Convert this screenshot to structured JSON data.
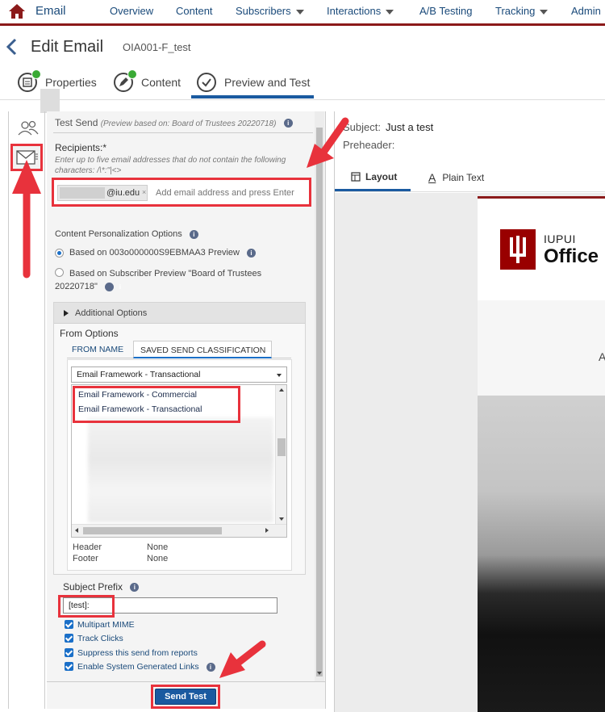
{
  "topnav": {
    "app_title": "Email",
    "items": [
      {
        "label": "Overview",
        "caret": false
      },
      {
        "label": "Content",
        "caret": false
      },
      {
        "label": "Subscribers",
        "caret": true
      },
      {
        "label": "Interactions",
        "caret": true
      },
      {
        "label": "A/B Testing",
        "caret": false
      },
      {
        "label": "Tracking",
        "caret": true
      },
      {
        "label": "Admin",
        "caret": false
      }
    ]
  },
  "header": {
    "title": "Edit Email",
    "subtitle": "OIA001-F_test"
  },
  "steps": [
    {
      "label": "Properties",
      "complete": true
    },
    {
      "label": "Content",
      "complete": true
    },
    {
      "label": "Preview and Test",
      "complete": false,
      "active": true
    }
  ],
  "test_send": {
    "title": "Test Send",
    "preview_note": "(Preview based on: Board of Trustees 20220718)",
    "recipients_label": "Recipients:*",
    "recipients_help": "Enter up to five email addresses that do not contain the following characters: /\\*:\"|<>",
    "chip_domain": "@iu.edu",
    "chip_remove": "×",
    "recipient_placeholder": "Add email address and press Enter",
    "personalization_title": "Content Personalization Options",
    "radio_option_1": "Based on 003o000000S9EBMAA3 Preview",
    "radio_option_2": "Based on Subscriber Preview \"Board of Trustees 20220718\"",
    "additional_options": "Additional Options",
    "from_options": "From Options",
    "tabs": [
      "FROM NAME",
      "SAVED SEND CLASSIFICATION"
    ],
    "selected_classification": "Email Framework - Transactional",
    "classification_list": [
      "Email Framework - Commercial",
      "Email Framework - Transactional"
    ],
    "header_label": "Header",
    "header_value": "None",
    "footer_label": "Footer",
    "footer_value": "None",
    "subject_prefix_label": "Subject Prefix",
    "subject_prefix_value": "[test]:",
    "checkboxes": [
      "Multipart MIME",
      "Track Clicks",
      "Suppress this send from reports",
      "Enable System Generated Links"
    ],
    "send_button": "Send Test"
  },
  "preview": {
    "subject_label": "Subject:",
    "subject_value": "Just a test",
    "preheader_label": "Preheader:",
    "tabs": [
      "Layout",
      "Plain Text"
    ],
    "brand_line1": "IUPUI",
    "brand_line2": "Office",
    "body_letter": "A"
  },
  "colors": {
    "brand_red": "#8b1a1a",
    "primary_blue": "#1a5aa0",
    "annotation_red": "#e8323c",
    "success_green": "#3aaa35"
  }
}
